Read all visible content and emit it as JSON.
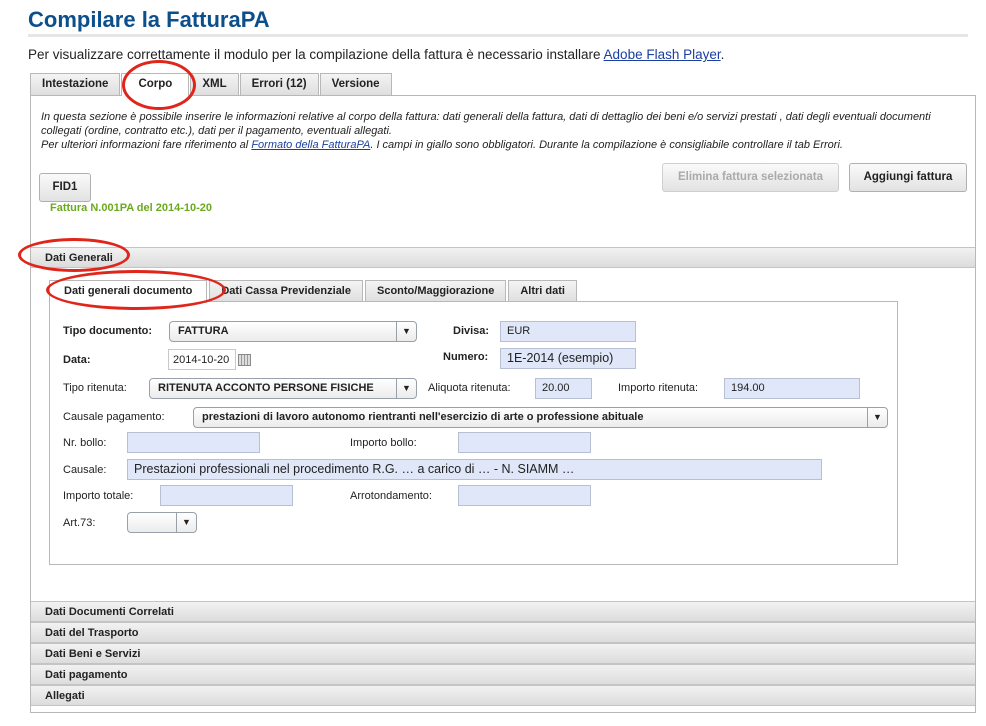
{
  "page": {
    "title": "Compilare la FatturaPA",
    "flash_text": "Per visualizzare correttamente il modulo per la compilazione della fattura è necessario installare ",
    "flash_link": "Adobe Flash Player",
    "flash_suffix": "."
  },
  "main_tabs": [
    {
      "label": "Intestazione"
    },
    {
      "label": "Corpo"
    },
    {
      "label": "XML"
    },
    {
      "label": "Errori (12)"
    },
    {
      "label": "Versione"
    }
  ],
  "info": {
    "line1": "In questa sezione è possibile inserire le informazioni relative al corpo della fattura: dati generali della fattura, dati di dettaglio dei beni e/o servizi prestati , dati degli eventuali documenti collegati (ordine, contratto etc.), dati per il pagamento, eventuali allegati.",
    "line2_pre": "Per ulteriori informazioni fare riferimento al ",
    "line2_link": "Formato della FatturaPA",
    "line2_post": ". I campi in giallo sono obbligatori. Durante la compilazione è consigliabile controllare il tab Errori."
  },
  "invoice": {
    "fid_button": "FID1",
    "label": "Fattura N.001PA del 2014-10-20",
    "delete_button": "Elimina fattura selezionata",
    "add_button": "Aggiungi fattura"
  },
  "sections": {
    "dati_generali": "Dati Generali",
    "collapsed": [
      "Dati Documenti Correlati",
      "Dati del Trasporto",
      "Dati Beni e Servizi",
      "Dati pagamento",
      "Allegati"
    ]
  },
  "inner_tabs": [
    {
      "label": "Dati generali documento"
    },
    {
      "label": "Dati Cassa Previdenziale"
    },
    {
      "label": "Sconto/Maggiorazione"
    },
    {
      "label": "Altri dati"
    }
  ],
  "form": {
    "tipo_documento": {
      "label": "Tipo documento:",
      "value": "FATTURA"
    },
    "divisa": {
      "label": "Divisa:",
      "value": "EUR"
    },
    "data": {
      "label": "Data:",
      "value": "2014-10-20"
    },
    "numero": {
      "label": "Numero:",
      "value": "1E-2014 (esempio)"
    },
    "tipo_ritenuta": {
      "label": "Tipo ritenuta:",
      "value": "RITENUTA ACCONTO PERSONE FISICHE"
    },
    "aliquota_ritenuta": {
      "label": "Aliquota ritenuta:",
      "value": "20.00"
    },
    "importo_ritenuta": {
      "label": "Importo ritenuta:",
      "value": "194.00"
    },
    "causale_pagamento": {
      "label": "Causale pagamento:",
      "value": "prestazioni di lavoro autonomo rientranti nell'esercizio di arte o professione abituale"
    },
    "nr_bollo": {
      "label": "Nr. bollo:",
      "value": ""
    },
    "importo_bollo": {
      "label": "Importo bollo:",
      "value": ""
    },
    "causale": {
      "label": "Causale:",
      "value": "Prestazioni professionali nel procedimento R.G. … a carico di … - N. SIAMM …"
    },
    "importo_totale": {
      "label": "Importo totale:",
      "value": ""
    },
    "arrotondamento": {
      "label": "Arrotondamento:",
      "value": ""
    },
    "art73": {
      "label": "Art.73:",
      "value": ""
    }
  },
  "icons": {
    "dropdown": "chevron-down-icon",
    "calendar": "calendar-icon"
  },
  "colors": {
    "title": "#0d4f8b",
    "fattura_label": "#6aaa1e",
    "annotation": "#e0251a",
    "field_bg": "#dfe7f8"
  }
}
